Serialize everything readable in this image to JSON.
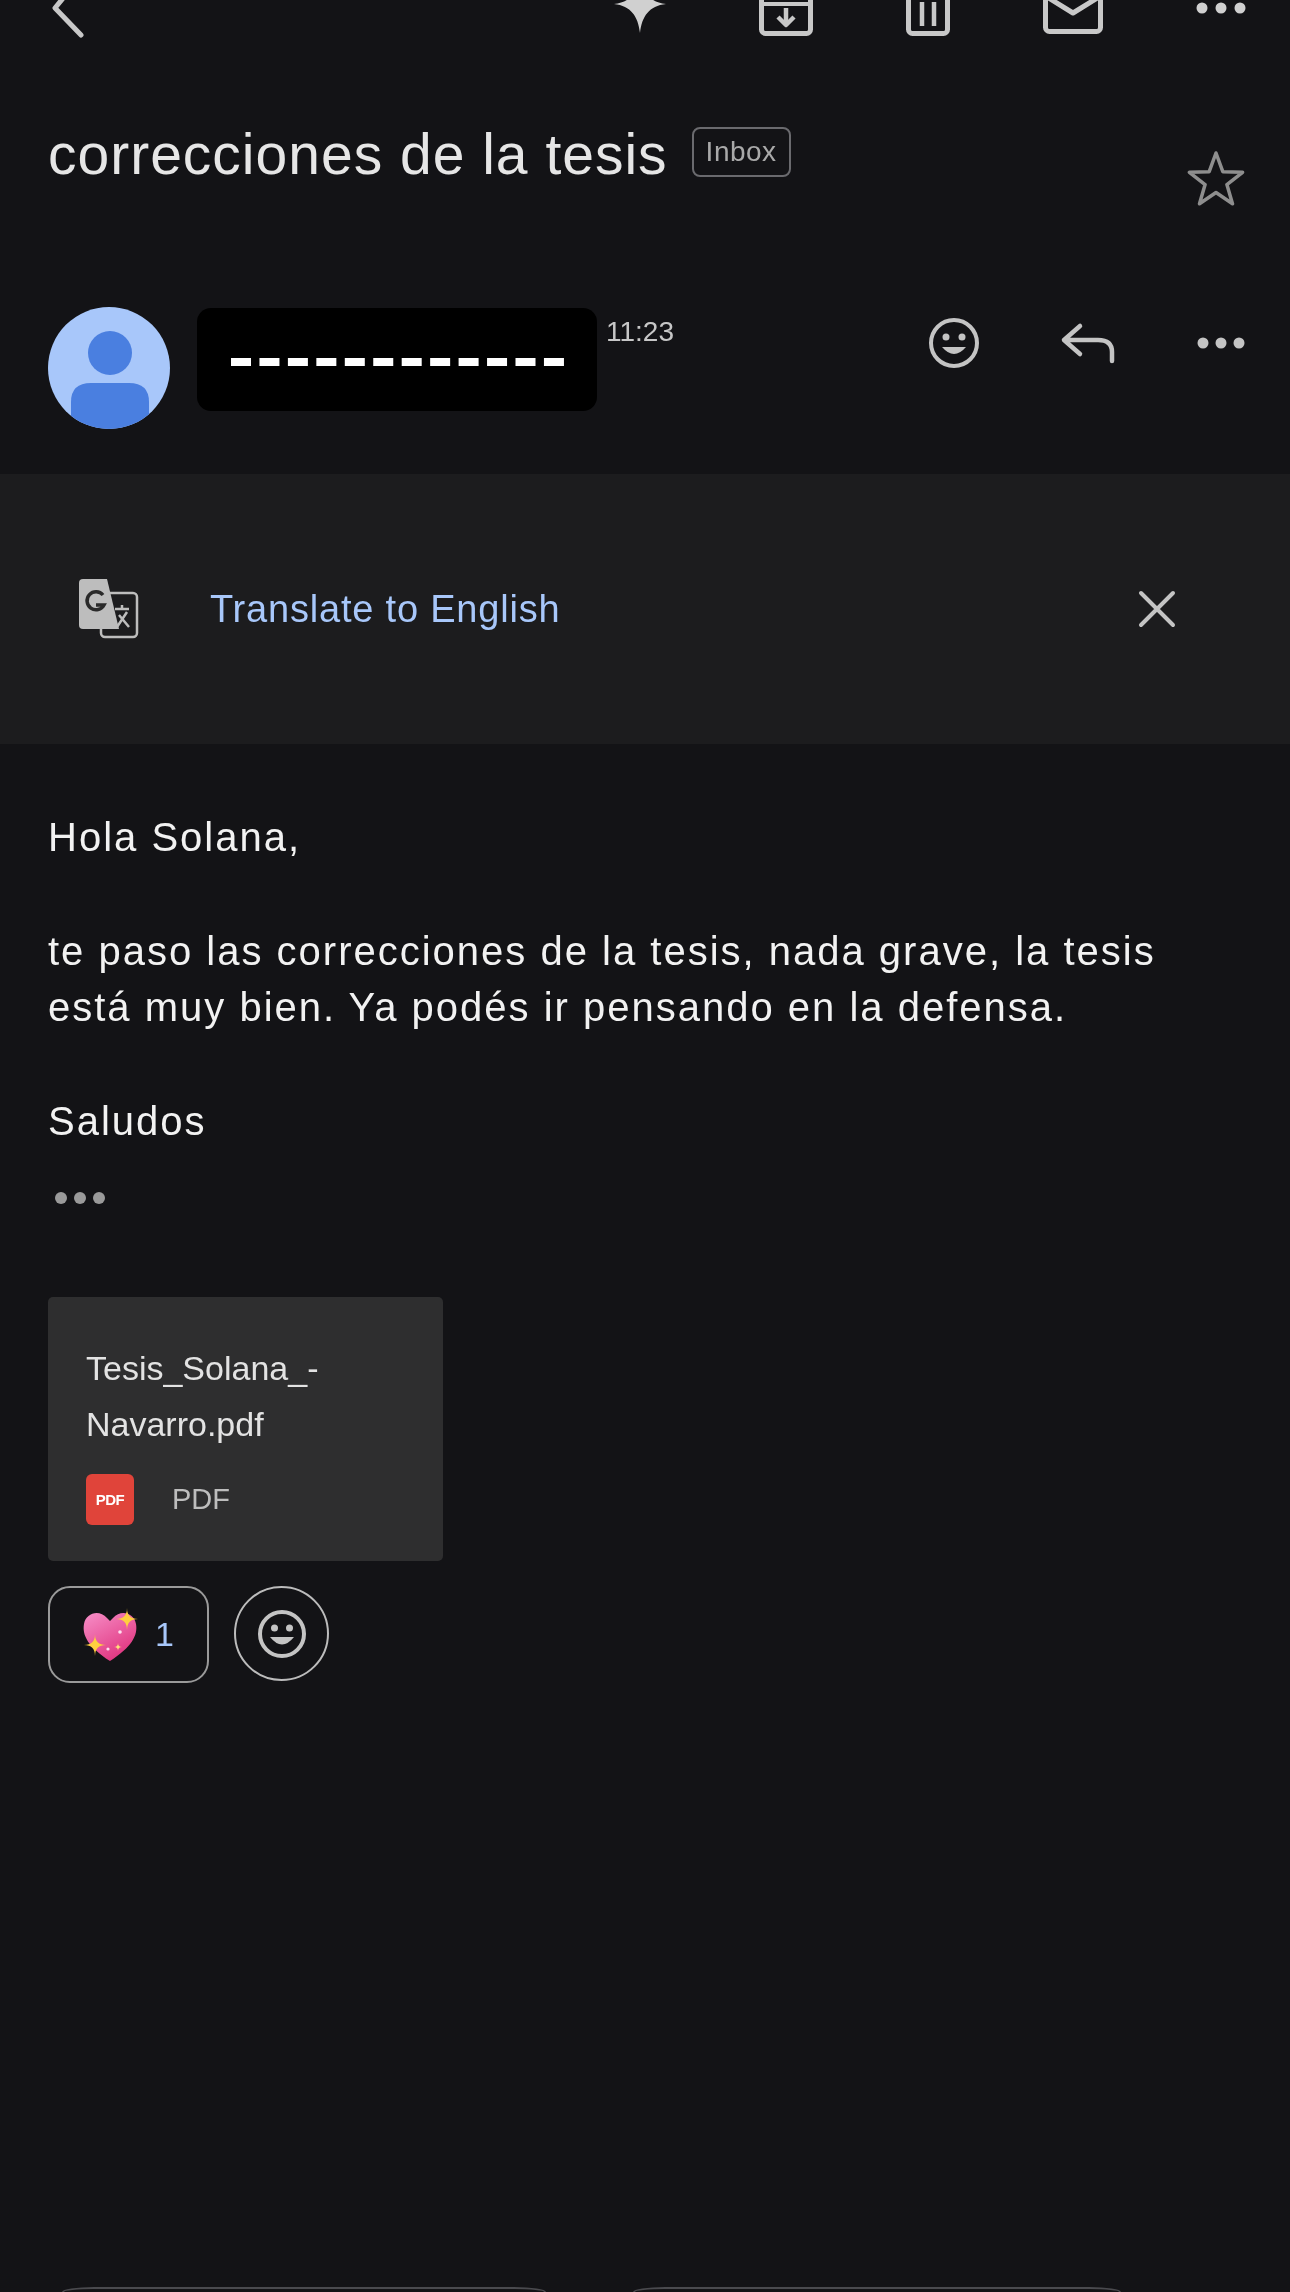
{
  "subject": {
    "title": "correcciones de la tesis",
    "label": "Inbox",
    "starred": false
  },
  "message": {
    "time": "11:23"
  },
  "translate_bar": {
    "link": "Translate to English"
  },
  "body": {
    "paragraphs": [
      "Hola Solana,",
      "te paso las correcciones de la tesis, nada grave, la tesis está muy bien. Ya podés ir pensando en la defensa.",
      "Saludos"
    ]
  },
  "attachments": [
    {
      "name": "Tesis_Solana_-Navarro.pdf",
      "icon_text": "PDF",
      "type": "PDF"
    }
  ],
  "reactions": [
    {
      "count": "1"
    }
  ]
}
